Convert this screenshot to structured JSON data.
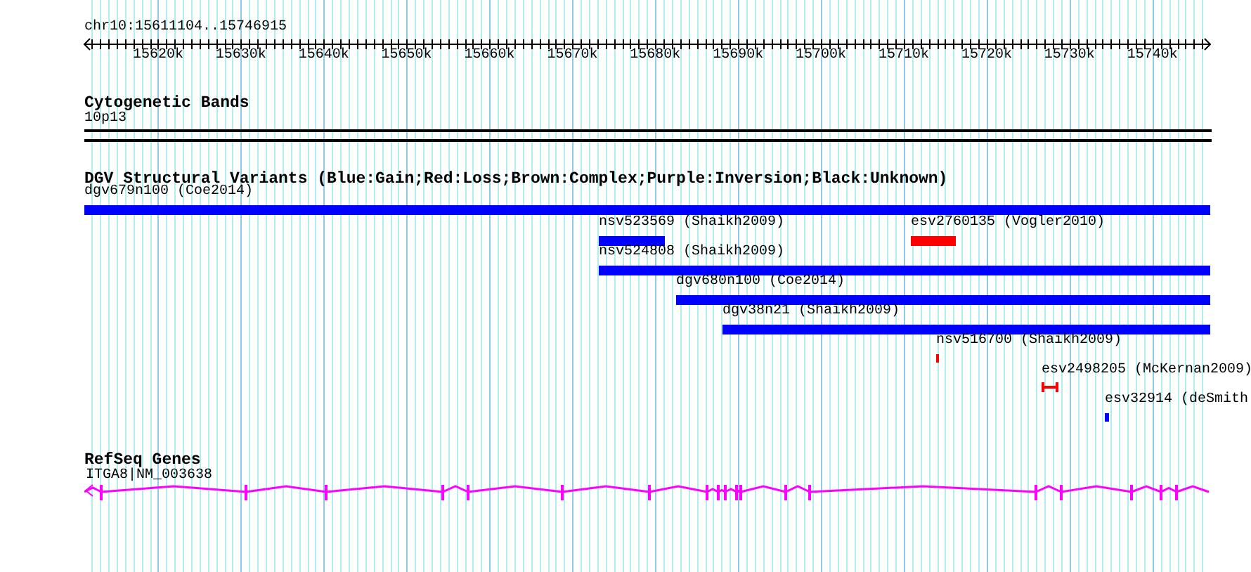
{
  "ruler": {
    "title": "chr10:15611104..15746915",
    "ticks": [
      "15620k",
      "15630k",
      "15640k",
      "15650k",
      "15660k",
      "15670k",
      "15680k",
      "15690k",
      "15700k",
      "15710k",
      "15720k",
      "15730k",
      "15740k"
    ]
  },
  "tracks": [
    {
      "kind": "cytoband",
      "title": "Cytogenetic Bands",
      "features": [
        {
          "label": "10p13"
        }
      ]
    },
    {
      "kind": "variants",
      "title": "DGV Structural Variants (Blue:Gain;Red:Loss;Brown:Complex;Purple:Inversion;Black:Unknown)",
      "features": [
        {
          "label": "dgv679n100 (Coe2014)",
          "color": "#0000ff",
          "kind": "bar"
        },
        {
          "label": "nsv523569 (Shaikh2009)",
          "color": "#0000ff",
          "kind": "bar"
        },
        {
          "label": "esv2760135 (Vogler2010)",
          "color": "#ff0000",
          "kind": "bar"
        },
        {
          "label": "nsv524808 (Shaikh2009)",
          "color": "#0000ff",
          "kind": "bar"
        },
        {
          "label": "dgv680n100 (Coe2014)",
          "color": "#0000ff",
          "kind": "bar"
        },
        {
          "label": "dgv38n21 (Shaikh2009)",
          "color": "#0000ff",
          "kind": "bar"
        },
        {
          "label": "nsv516700 (Shaikh2009)",
          "color": "#ff0000",
          "kind": "bar"
        },
        {
          "label": "esv2498205 (McKernan2009)",
          "color": "#ff0000",
          "kind": "bracket"
        },
        {
          "label": "esv32914 (deSmith",
          "color": "#0000ff",
          "kind": "bar"
        }
      ]
    },
    {
      "kind": "genes",
      "title": "RefSeq Genes",
      "features": [
        {
          "label": "ITGA8|NM_003638"
        }
      ]
    }
  ]
}
